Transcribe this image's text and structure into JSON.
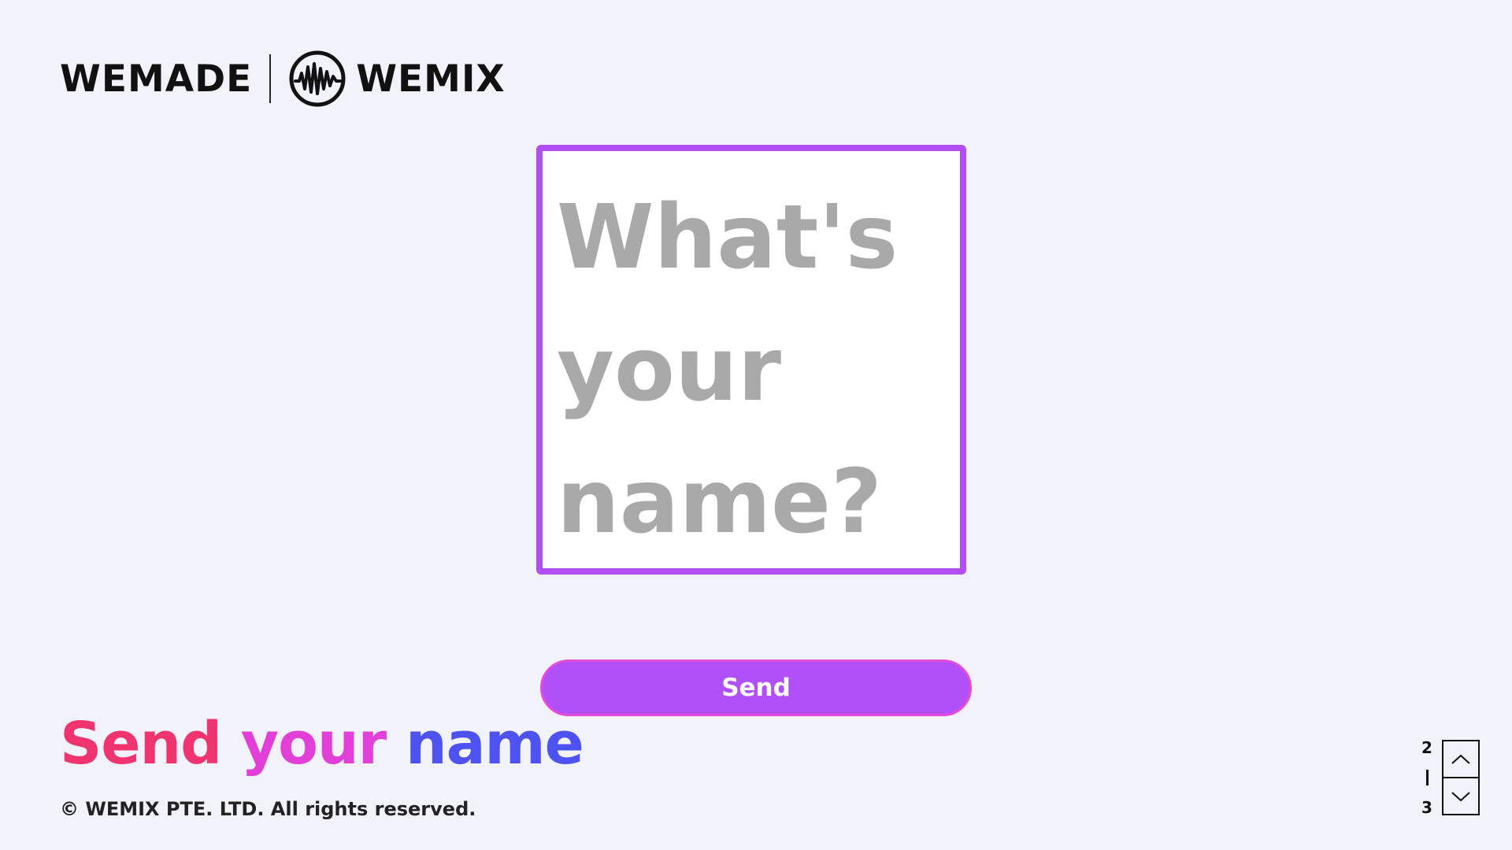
{
  "header": {
    "logo_wemade": "WEMADE",
    "logo_wemix": "WEMIX",
    "emblem_icon": "wemix-emblem-icon"
  },
  "name_box": {
    "placeholder": "What's your name?",
    "value": "",
    "border_color": "#b14ff2"
  },
  "send_button": {
    "label": "Send",
    "color": "#b14ff8"
  },
  "title": {
    "word1": "Send",
    "word2": "your",
    "word3": "name",
    "colors": [
      "#f0346f",
      "#e23ed8",
      "#4d52f0"
    ]
  },
  "footer": {
    "copyright": "© WEMIX PTE. LTD. All rights reserved."
  },
  "pager": {
    "current": "2",
    "total": "3",
    "up_icon": "chevron-up-icon",
    "down_icon": "chevron-down-icon"
  },
  "colors": {
    "background": "#f1f2fa"
  }
}
